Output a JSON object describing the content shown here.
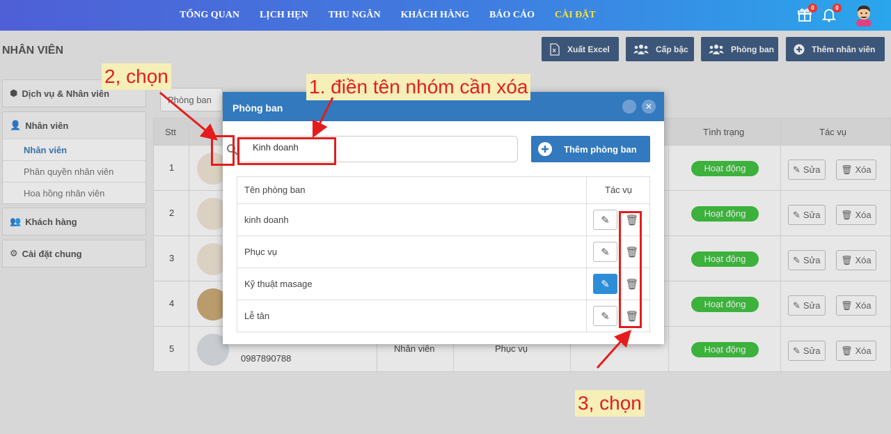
{
  "nav": {
    "items": [
      "TỔNG QUAN",
      "LỊCH HẸN",
      "THU NGÂN",
      "KHÁCH HÀNG",
      "BÁO CÁO",
      "CÀI ĐẶT"
    ],
    "active": "CÀI ĐẶT",
    "gift_badge": "0",
    "bell_badge": "0"
  },
  "page": {
    "title": "NHÂN VIÊN",
    "buttons": {
      "export": "Xuất Excel",
      "rank": "Cấp bậc",
      "dept": "Phòng ban",
      "add_staff": "Thêm nhân viên"
    }
  },
  "sidebar": {
    "services": "Dịch vụ & Nhân viên",
    "staff": "Nhân viên",
    "staff_items": [
      "Nhân viên",
      "Phân quyền nhân viên",
      "Hoa hồng nhân viên"
    ],
    "customers": "Khách hàng",
    "settings": "Cài đặt chung"
  },
  "main": {
    "filter": "Phòng ban",
    "headers": {
      "stt": "Stt",
      "status": "Tình trạng",
      "actions": "Tác vụ"
    },
    "rows": [
      {
        "stt": "1",
        "status": "Hoạt động"
      },
      {
        "stt": "2",
        "status": "Hoạt động"
      },
      {
        "stt": "3",
        "status": "Hoạt động"
      },
      {
        "stt": "4",
        "status": "Hoạt động"
      },
      {
        "stt": "5",
        "status": "Hoạt động",
        "phone": "0987890788",
        "role": "Nhân viên",
        "dept": "Phục vụ"
      }
    ],
    "edit_label": "Sửa",
    "delete_label": "Xóa"
  },
  "modal": {
    "title": "Phòng ban",
    "search_value": "Kinh doanh",
    "add_button": "Thêm phòng ban",
    "col_name": "Tên phòng ban",
    "col_actions": "Tác vụ",
    "departments": [
      "kinh doanh",
      "Phục vụ",
      "Kỹ thuật masage",
      "Lễ tân"
    ]
  },
  "annotations": {
    "step1": "1. điền tên nhóm cần xóa",
    "step2": "2, chọn",
    "step3": "3, chọn"
  },
  "colors": {
    "accent": "#3279be",
    "status_green": "#2fbe2f",
    "annotation_red": "#e51c1c",
    "nav_active": "#ffe033"
  }
}
